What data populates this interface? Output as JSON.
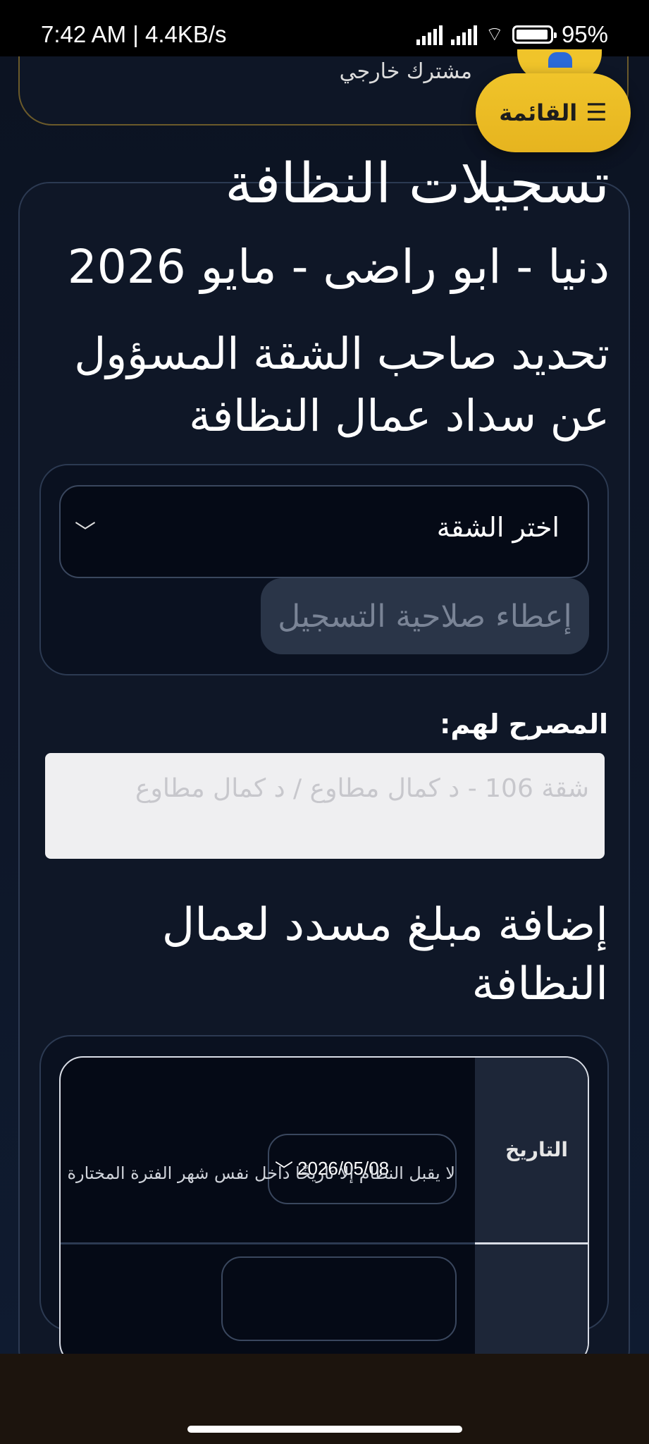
{
  "status_bar": {
    "time_speed": "7:42 AM | 4.4KB/s",
    "battery": "95%"
  },
  "header": {
    "user_role": "مشترك خارجي",
    "menu_label": "القائمة",
    "menu_icon": "hamburger-icon"
  },
  "main": {
    "title": "تسجيلات النظافة",
    "subtitle": "دنيا - ابو راضى - مايو 2026",
    "section_title": "تحديد صاحب الشقة المسؤول عن سداد عمال النظافة",
    "apartment_select_placeholder": "اختر الشقة",
    "grant_button": "إعطاء صلاحية التسجيل",
    "allowed_label": "المصرح لهم:",
    "allowed_value": "شقة 106 - د كمال مطاوع / د كمال مطاوع",
    "add_payment_title": "إضافة مبلغ مسدد لعمال النظافة",
    "form": {
      "date_label": "التاريخ",
      "date_value": "2026/05/08",
      "date_hint": "لا يقبل النظام إلا تاريخًا داخل نفس شهر الفترة المختارة"
    }
  },
  "colors": {
    "accent": "#f0c42a",
    "background": "#0c1322",
    "card_border": "#2c3a52"
  }
}
